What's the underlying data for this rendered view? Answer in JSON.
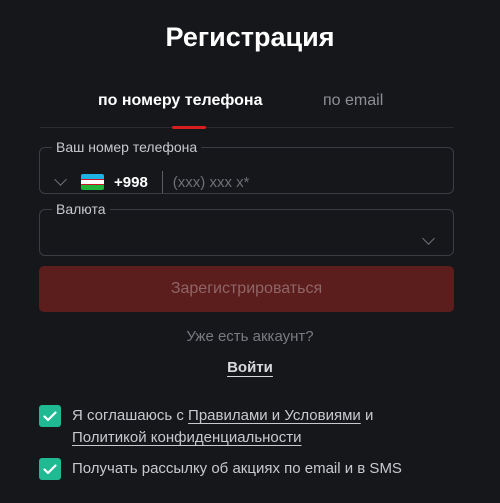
{
  "page": {
    "title": "Регистрация"
  },
  "tabs": [
    {
      "label": "по номеру телефона",
      "active": true
    },
    {
      "label": "по email",
      "active": false
    }
  ],
  "phone": {
    "legend": "Ваш номер телефона",
    "country_code": "+998",
    "flag": "uzbekistan-flag",
    "placeholder": "(xxx) xxx x*",
    "value": ""
  },
  "currency": {
    "legend": "Валюта",
    "value": ""
  },
  "submit": {
    "label": "Зарегистрироваться"
  },
  "account": {
    "prompt": "Уже есть аккаунт?",
    "login_label": "Войти"
  },
  "consents": [
    {
      "checked": true,
      "prefix": "Я соглашаюсь с ",
      "link1": "Правилами и Условиями",
      "middle": " и ",
      "link2": "Политикой конфиденциальности"
    },
    {
      "checked": true,
      "text": "Получать рассылку об акциях по email и в SMS"
    }
  ],
  "colors": {
    "background": "#16171b",
    "accent_red": "#d81e1e",
    "submit_disabled": "#5c1d1d",
    "checkbox": "#1fb992"
  }
}
